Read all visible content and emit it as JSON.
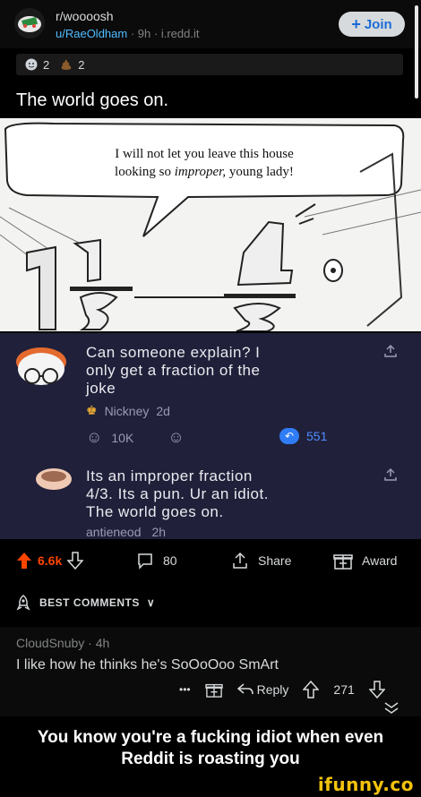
{
  "header": {
    "subreddit": "r/woooosh",
    "user": "u/RaeOldham",
    "meta_sep1": " · ",
    "time": "9h",
    "meta_sep2": " · ",
    "domain": "i.redd.it",
    "join_label": "Join"
  },
  "awards": {
    "items": [
      {
        "icon": "award-face-icon",
        "count": "2"
      },
      {
        "icon": "award-poop-icon",
        "count": "2"
      }
    ]
  },
  "post": {
    "title": "The world goes on."
  },
  "comic": {
    "speech_line1": "I will not let you leave this house",
    "speech_line2a": "looking so ",
    "speech_line2b": "improper,",
    "speech_line2c": " young lady!"
  },
  "overlay": {
    "comment1": {
      "line1": "Can someone explain? I",
      "line2": "only get a fraction of the",
      "line3": "joke",
      "author": "Nickney",
      "time": "2d",
      "upvotes": "10K",
      "count": "551"
    },
    "comment2": {
      "line1": "Its an improper fraction",
      "line2": "4/3. Its a pun. Ur an idiot.",
      "line3": "The world goes on.",
      "author": "antieneod",
      "time": "2h"
    }
  },
  "actions": {
    "score": "6.6k",
    "comments": "80",
    "share": "Share",
    "award": "Award"
  },
  "best": {
    "label": "BEST COMMENTS"
  },
  "comment": {
    "author": "CloudSnuby",
    "sep": " · ",
    "time": "4h",
    "body": "I like how he thinks he's SoOoOoo SmArt",
    "more": "•••",
    "reply": "Reply",
    "score": "271"
  },
  "caption": {
    "line1": "You know you're a fucking idiot when even",
    "line2": "Reddit is roasting you"
  },
  "watermark": "ifunny.co",
  "colors": {
    "accent": "#4fbcff",
    "upvote": "#ff4500",
    "overlay_bg": "#20203a",
    "watermark": "#f3c20c"
  }
}
